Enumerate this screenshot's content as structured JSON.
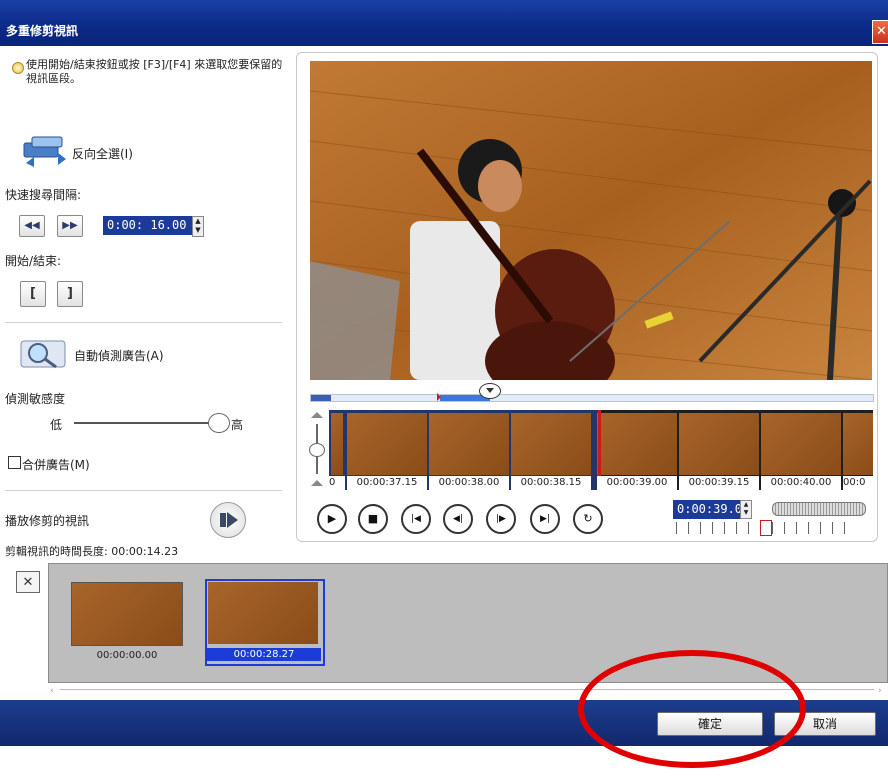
{
  "window": {
    "title": "多重修剪視訊",
    "close_glyph": "✕"
  },
  "left": {
    "instruction": "使用開始/結束按鈕或按 [F3]/[F4] 來選取您要保留的視訊區段。",
    "invert_label": "反向全選(I)",
    "quick_search_label": "快速搜尋間隔:",
    "quick_search_value": "0:00: 16.00",
    "start_end_label": "開始/結束:",
    "start_glyph": "[",
    "end_glyph": "]",
    "auto_detect_label": "自動偵測廣告(A)",
    "sensitivity_label": "偵測敏感度",
    "sensitivity_low": "低",
    "sensitivity_high": "高",
    "sensitivity_level": 1.0,
    "merge_label": "合併廣告(M)",
    "merge_checked": false,
    "play_trimmed_label": "播放修剪的視訊",
    "duration_label": "剪輯視訊的時間長度: 00:00:14.23",
    "rewind_glyph": "◀◀",
    "forward_glyph": "▶▶"
  },
  "strip": {
    "frames": [
      {
        "label": "0"
      },
      {
        "label": "00:00:37.15"
      },
      {
        "label": "00:00:38.00"
      },
      {
        "label": "00:00:38.15"
      },
      {
        "label": "00:00:39.00"
      },
      {
        "label": "00:00:39.15"
      },
      {
        "label": "00:00:40.00"
      },
      {
        "label": "00:0"
      }
    ]
  },
  "controls": {
    "play_glyph": "▶",
    "stop_glyph": "■",
    "first_glyph": "|◀",
    "prev_frame_glyph": "◀|",
    "next_frame_glyph": "|▶",
    "last_glyph": "▶|",
    "repeat_glyph": "↻",
    "timecode": "0:00:39.0"
  },
  "clips": {
    "delete_glyph": "✕",
    "items": [
      {
        "time": "00:00:00.00",
        "selected": false
      },
      {
        "time": "00:00:28.27",
        "selected": true
      }
    ]
  },
  "footer": {
    "ok_label": "確定",
    "cancel_label": "取消"
  },
  "colors": {
    "title_bar": "#0b2a86",
    "footer_bar": "#10286d",
    "selection": "#1b3cd9",
    "annotation": "#e10000"
  }
}
